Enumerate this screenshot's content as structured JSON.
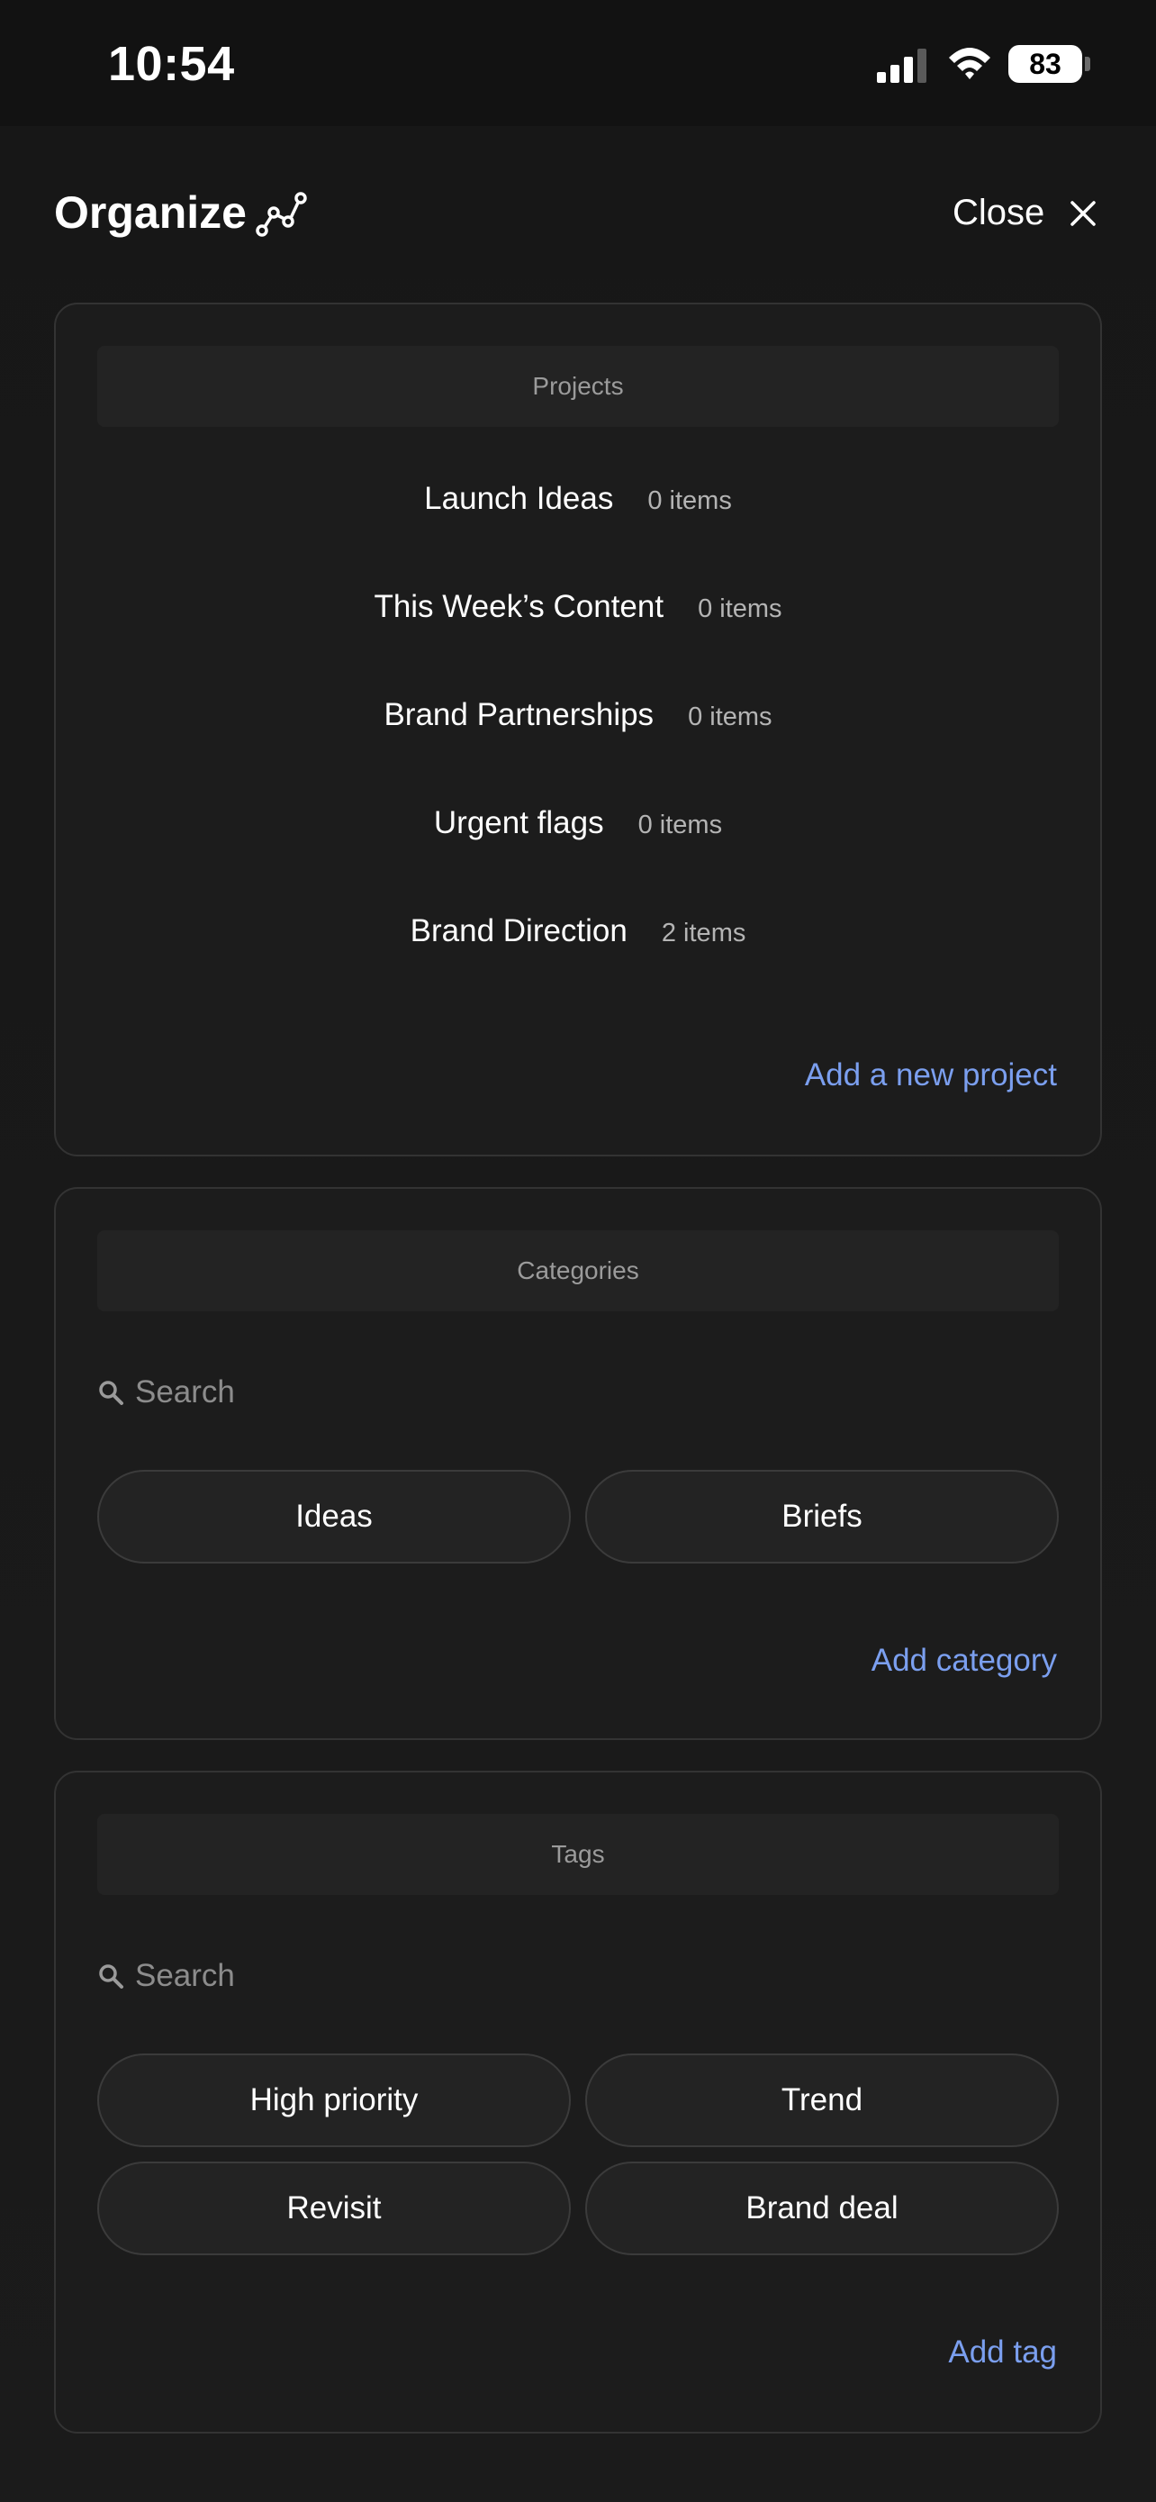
{
  "status_bar": {
    "time": "10:54",
    "battery": "83"
  },
  "header": {
    "title": "Organize",
    "close_label": "Close"
  },
  "projects": {
    "heading": "Projects",
    "items": [
      {
        "name": "Launch Ideas",
        "count": "0 items"
      },
      {
        "name": "This Week’s Content",
        "count": "0 items"
      },
      {
        "name": "Brand Partnerships",
        "count": "0 items"
      },
      {
        "name": "Urgent flags",
        "count": "0 items"
      },
      {
        "name": "Brand Direction",
        "count": "2 items"
      }
    ],
    "add_label": "Add a new project"
  },
  "categories": {
    "heading": "Categories",
    "search_placeholder": "Search",
    "chips": [
      "Ideas",
      "Briefs"
    ],
    "add_label": "Add category"
  },
  "tags": {
    "heading": "Tags",
    "search_placeholder": "Search",
    "chips": [
      "High priority",
      "Trend",
      "Revisit",
      "Brand deal"
    ],
    "add_label": "Add tag"
  },
  "colors": {
    "background": "#161616",
    "card": "#1c1c1c",
    "link": "#7b9fef",
    "muted": "#9b9b9b"
  }
}
